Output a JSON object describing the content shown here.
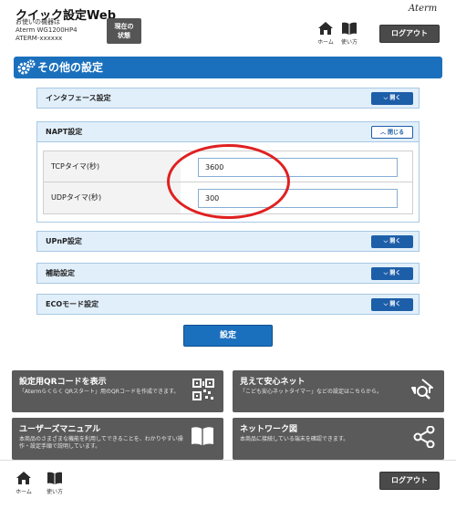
{
  "header": {
    "title": "クイック設定Web",
    "device_label": "お使いの機器は",
    "device_model": "Aterm WG1200HP4",
    "device_name": "ATERM-xxxxxx",
    "status_button": "現在の状態",
    "home_label": "ホーム",
    "manual_label": "使い方",
    "brand": "Aterm",
    "logout_label": "ログアウト"
  },
  "section": {
    "title": "その他の設定"
  },
  "accordions": [
    {
      "label": "インタフェース設定",
      "button": "開く",
      "state": "collapsed"
    },
    {
      "label": "NAPT設定",
      "button": "閉じる",
      "state": "expanded"
    },
    {
      "label": "UPnP設定",
      "button": "開く",
      "state": "collapsed"
    },
    {
      "label": "補助設定",
      "button": "開く",
      "state": "collapsed"
    },
    {
      "label": "ECOモード設定",
      "button": "開く",
      "state": "collapsed"
    }
  ],
  "napt": {
    "rows": [
      {
        "label": "TCPタイマ(秒)",
        "value": "3600"
      },
      {
        "label": "UDPタイマ(秒)",
        "value": "300"
      }
    ]
  },
  "submit_label": "設定",
  "tiles": [
    {
      "title": "設定用QRコードを表示",
      "desc": "「Atermらくらく QRスタート」用のQRコードを作成できます。",
      "icon": "qr-code-icon"
    },
    {
      "title": "見えて安心ネット",
      "desc": "「こども安心ネットタイマー」などの設定はこちらから。",
      "icon": "home-search-icon"
    },
    {
      "title": "ユーザーズマニュアル",
      "desc": "本商品のさまざまな機能を利用してできることを、わかりやすい操作・設定手順で説明しています。",
      "icon": "book-icon"
    },
    {
      "title": "ネットワーク図",
      "desc": "本商品に接続している端末を確認できます。",
      "icon": "share-network-icon"
    }
  ],
  "footer": {
    "home_label": "ホーム",
    "manual_label": "使い方",
    "logout_label": "ログアウト"
  },
  "colors": {
    "accent": "#1b70bd",
    "accordion_bg": "#e1effa",
    "tile_bg": "#5a5a5a",
    "annotation": "#e02020"
  }
}
